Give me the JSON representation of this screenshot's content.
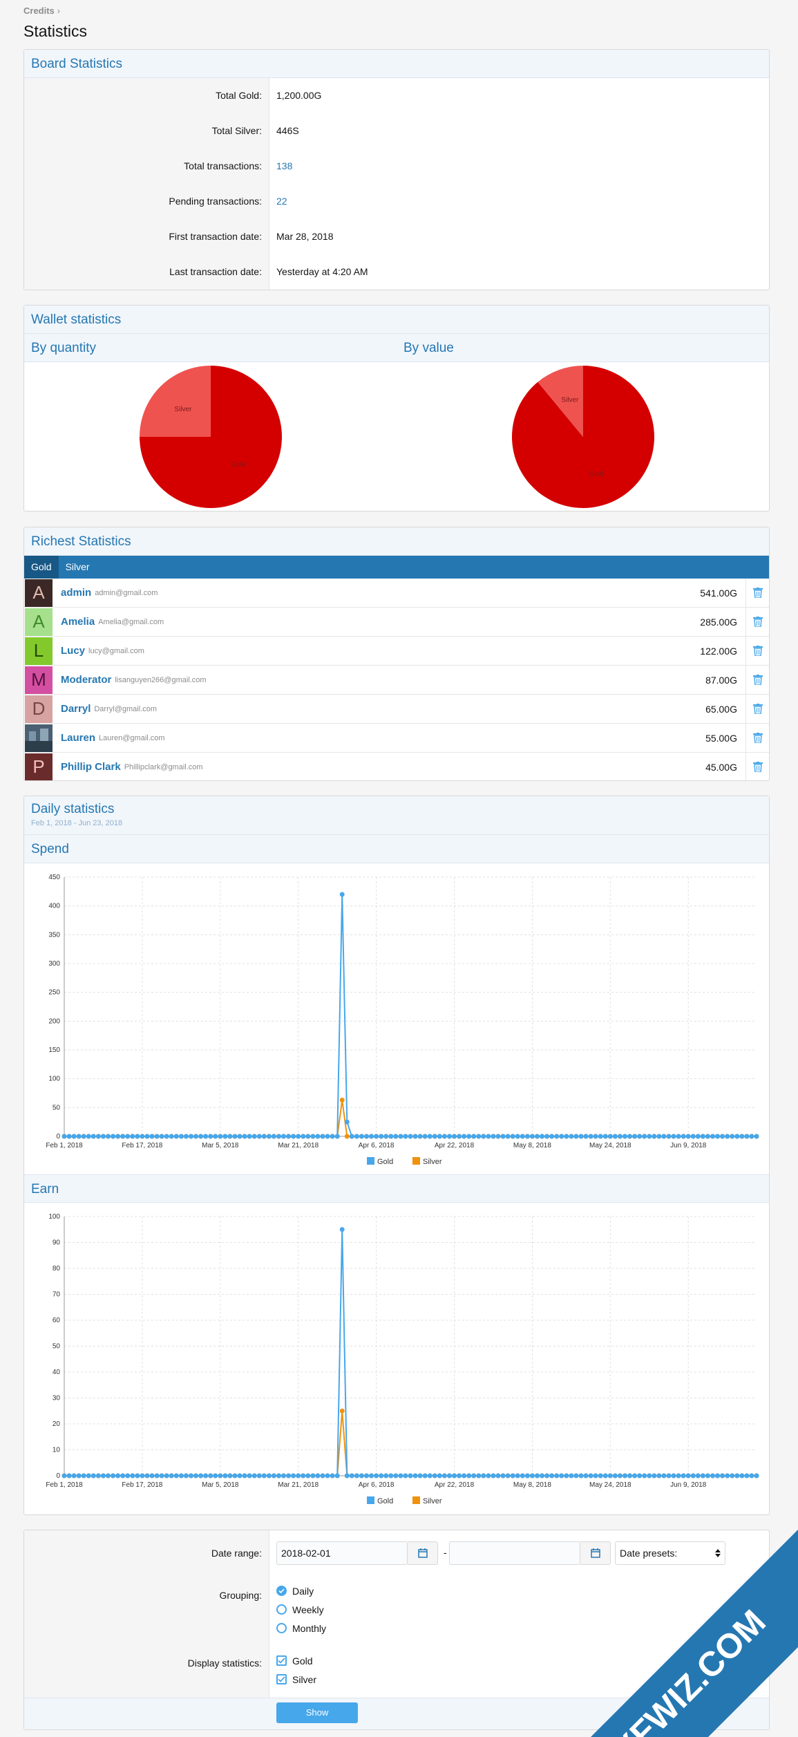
{
  "breadcrumb": {
    "label": "Credits",
    "sep": "›"
  },
  "page_title": "Statistics",
  "board": {
    "title": "Board Statistics",
    "rows": [
      {
        "label": "Total Gold:",
        "value": "1,200.00G",
        "link": false
      },
      {
        "label": "Total Silver:",
        "value": "446S",
        "link": false
      },
      {
        "label": "Total transactions:",
        "value": "138",
        "link": true
      },
      {
        "label": "Pending transactions:",
        "value": "22",
        "link": true
      },
      {
        "label": "First transaction date:",
        "value": "Mar 28, 2018",
        "link": false
      },
      {
        "label": "Last transaction date:",
        "value": "Yesterday at 4:20 AM",
        "link": false
      }
    ]
  },
  "wallet": {
    "title": "Wallet statistics",
    "by_quantity": "By quantity",
    "by_value": "By value"
  },
  "chart_data": [
    {
      "type": "pie",
      "title": "By quantity",
      "labels": [
        "Gold",
        "Silver"
      ],
      "values": [
        75,
        25
      ],
      "colors": [
        "#d40000",
        "#ef5350"
      ]
    },
    {
      "type": "pie",
      "title": "By value",
      "labels": [
        "Gold",
        "Silver"
      ],
      "values": [
        89,
        11
      ],
      "colors": [
        "#d40000",
        "#ef5350"
      ]
    },
    {
      "type": "line",
      "title": "Spend",
      "x_ticks": [
        "Feb 1, 2018",
        "Feb 17, 2018",
        "Mar 5, 2018",
        "Mar 21, 2018",
        "Apr 6, 2018",
        "Apr 22, 2018",
        "May 8, 2018",
        "May 24, 2018",
        "Jun 9, 2018"
      ],
      "x_range": [
        "2018-02-01",
        "2018-06-23"
      ],
      "ylim": [
        0,
        450
      ],
      "y_ticks": [
        0,
        50,
        100,
        150,
        200,
        250,
        300,
        350,
        400,
        450
      ],
      "series": [
        {
          "name": "Gold",
          "color": "#47a7eb",
          "points": [
            [
              "2018-03-29",
              0
            ],
            [
              "2018-03-30",
              420
            ],
            [
              "2018-03-31",
              25
            ],
            [
              "2018-04-01",
              0
            ]
          ]
        },
        {
          "name": "Silver",
          "color": "#f0920e",
          "points": [
            [
              "2018-03-29",
              0
            ],
            [
              "2018-03-30",
              63
            ],
            [
              "2018-03-31",
              0
            ]
          ]
        }
      ]
    },
    {
      "type": "line",
      "title": "Earn",
      "x_ticks": [
        "Feb 1, 2018",
        "Feb 17, 2018",
        "Mar 5, 2018",
        "Mar 21, 2018",
        "Apr 6, 2018",
        "Apr 22, 2018",
        "May 8, 2018",
        "May 24, 2018",
        "Jun 9, 2018"
      ],
      "x_range": [
        "2018-02-01",
        "2018-06-23"
      ],
      "ylim": [
        0,
        100
      ],
      "y_ticks": [
        0,
        10,
        20,
        30,
        40,
        50,
        60,
        70,
        80,
        90,
        100
      ],
      "series": [
        {
          "name": "Gold",
          "color": "#47a7eb",
          "points": [
            [
              "2018-03-29",
              0
            ],
            [
              "2018-03-30",
              95
            ],
            [
              "2018-03-31",
              0
            ]
          ]
        },
        {
          "name": "Silver",
          "color": "#f0920e",
          "points": [
            [
              "2018-03-29",
              0
            ],
            [
              "2018-03-30",
              25
            ],
            [
              "2018-03-31",
              0
            ]
          ]
        }
      ]
    }
  ],
  "richest": {
    "title": "Richest Statistics",
    "tabs": [
      "Gold",
      "Silver"
    ],
    "users": [
      {
        "initial": "A",
        "name": "admin",
        "email": "admin@gmail.com",
        "amount": "541.00G",
        "bg": "#3b2826",
        "fg": "#e0b8b0"
      },
      {
        "initial": "A",
        "name": "Amelia",
        "email": "Amelia@gmail.com",
        "amount": "285.00G",
        "bg": "#a6e08c",
        "fg": "#3f8b2a"
      },
      {
        "initial": "L",
        "name": "Lucy",
        "email": "lucy@gmail.com",
        "amount": "122.00G",
        "bg": "#83c92c",
        "fg": "#24470c"
      },
      {
        "initial": "M",
        "name": "Moderator",
        "email": "lisanguyen266@gmail.com",
        "amount": "87.00G",
        "bg": "#d44fa1",
        "fg": "#54103d"
      },
      {
        "initial": "D",
        "name": "Darryl",
        "email": "Darryl@gmail.com",
        "amount": "65.00G",
        "bg": "#d7a2a2",
        "fg": "#7a4444"
      },
      {
        "initial": "",
        "name": "Lauren",
        "email": "Lauren@gmail.com",
        "amount": "55.00G",
        "bg": "#4a6072",
        "fg": "#ffffff"
      },
      {
        "initial": "P",
        "name": "Phillip Clark",
        "email": "Phillipclark@gmail.com",
        "amount": "45.00G",
        "bg": "#6a2b2b",
        "fg": "#f0c0c0"
      }
    ]
  },
  "daily": {
    "title": "Daily statistics",
    "range": "Feb 1, 2018 - Jun 23, 2018",
    "spend": "Spend",
    "earn": "Earn"
  },
  "form": {
    "date_range_label": "Date range:",
    "date_start": "2018-02-01",
    "date_end": "",
    "dash": "-",
    "presets": "Date presets:",
    "grouping_label": "Grouping:",
    "grouping": [
      "Daily",
      "Weekly",
      "Monthly"
    ],
    "display_label": "Display statistics:",
    "display": [
      "Gold",
      "Silver"
    ],
    "show": "Show"
  },
  "watermark": "XFWIZ.COM"
}
